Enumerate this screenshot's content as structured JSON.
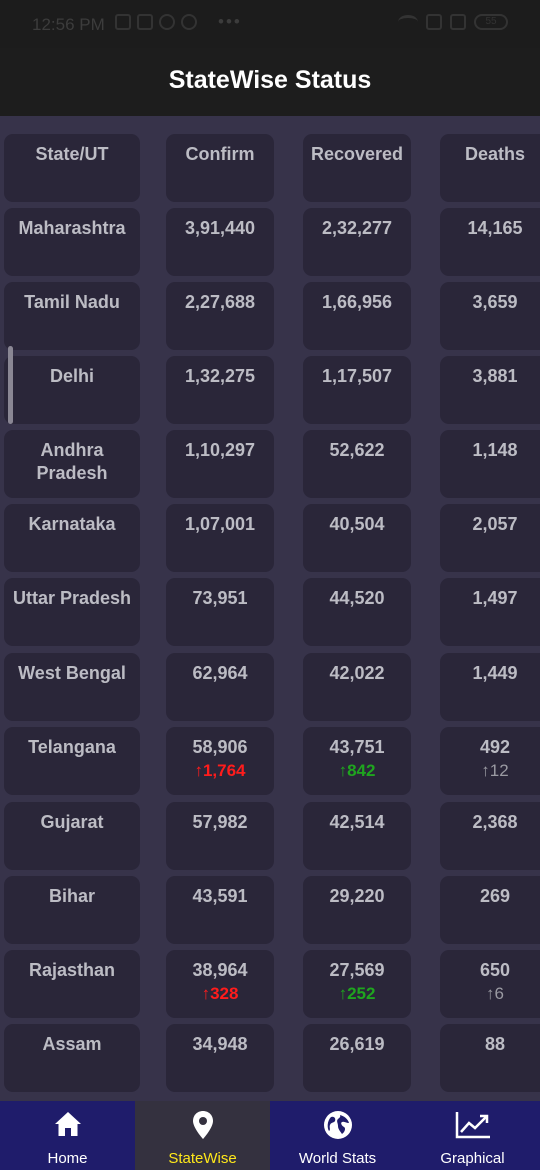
{
  "status_bar": {
    "time": "12:56 PM",
    "battery": "55"
  },
  "app_bar": {
    "title": "StateWise Status"
  },
  "table": {
    "headers": [
      "State/UT",
      "Confirm",
      "Recovered",
      "Deaths"
    ],
    "rows": [
      {
        "state": "Maharashtra",
        "confirm": "3,91,440",
        "recovered": "2,32,277",
        "deaths": "14,165"
      },
      {
        "state": "Tamil Nadu",
        "confirm": "2,27,688",
        "recovered": "1,66,956",
        "deaths": "3,659"
      },
      {
        "state": "Delhi",
        "confirm": "1,32,275",
        "recovered": "1,17,507",
        "deaths": "3,881"
      },
      {
        "state": "Andhra Pradesh",
        "confirm": "1,10,297",
        "recovered": "52,622",
        "deaths": "1,148"
      },
      {
        "state": "Karnataka",
        "confirm": "1,07,001",
        "recovered": "40,504",
        "deaths": "2,057"
      },
      {
        "state": "Uttar Pradesh",
        "confirm": "73,951",
        "recovered": "44,520",
        "deaths": "1,497"
      },
      {
        "state": "West Bengal",
        "confirm": "62,964",
        "recovered": "42,022",
        "deaths": "1,449"
      },
      {
        "state": "Telangana",
        "confirm": "58,906",
        "confirm_delta": "↑1,764",
        "recovered": "43,751",
        "recovered_delta": "↑842",
        "deaths": "492",
        "deaths_delta": "↑12"
      },
      {
        "state": "Gujarat",
        "confirm": "57,982",
        "recovered": "42,514",
        "deaths": "2,368"
      },
      {
        "state": "Bihar",
        "confirm": "43,591",
        "recovered": "29,220",
        "deaths": "269"
      },
      {
        "state": "Rajasthan",
        "confirm": "38,964",
        "confirm_delta": "↑328",
        "recovered": "27,569",
        "recovered_delta": "↑252",
        "deaths": "650",
        "deaths_delta": "↑6"
      },
      {
        "state": "Assam",
        "confirm": "34,948",
        "recovered": "26,619",
        "deaths": "88"
      }
    ]
  },
  "bottom_nav": {
    "items": [
      {
        "label": "Home",
        "icon": "home-icon"
      },
      {
        "label": "StateWise",
        "icon": "location-pin-icon"
      },
      {
        "label": "World Stats",
        "icon": "globe-icon"
      },
      {
        "label": "Graphical",
        "icon": "trending-chart-icon"
      }
    ],
    "active_index": 1
  },
  "colors": {
    "background": "#37334a",
    "cell": "#2a2639",
    "app_bar": "#1d1d1d",
    "nav": "#1f1c6b",
    "active_nav_label": "#ffe81a",
    "delta_up_red": "#ff1c1c",
    "delta_up_green": "#1fa51f"
  }
}
